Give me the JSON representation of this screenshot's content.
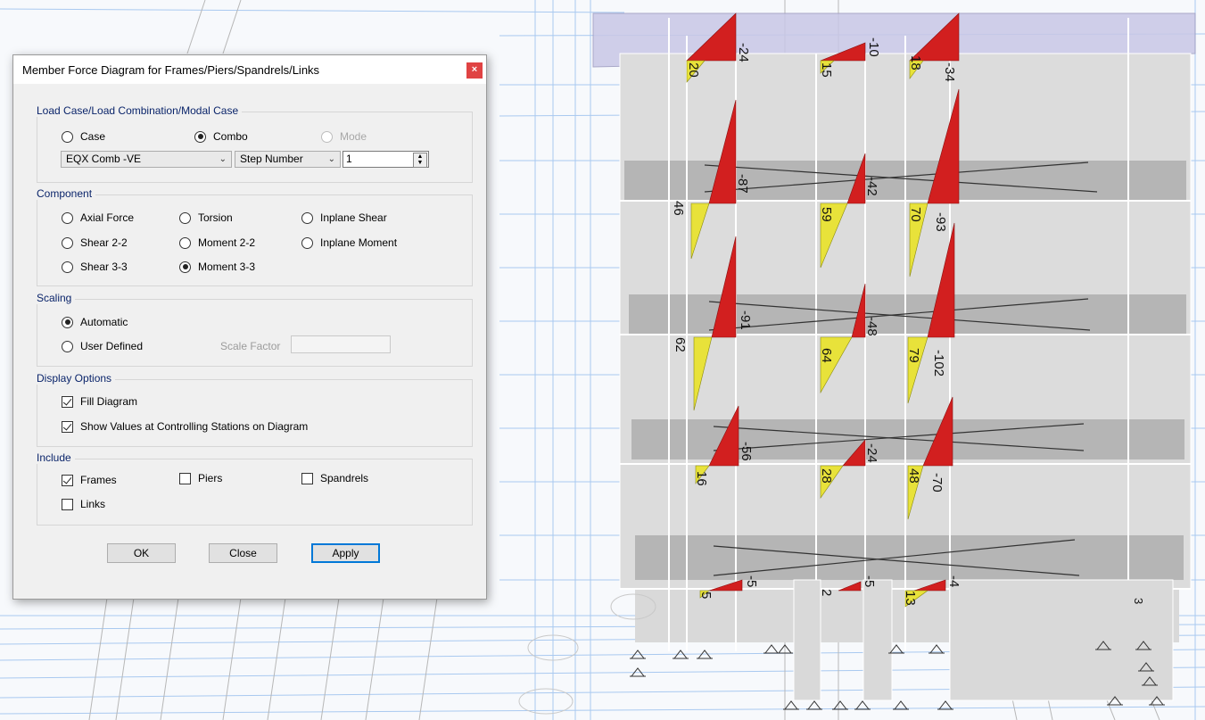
{
  "dialog": {
    "title": "Member Force Diagram for Frames/Piers/Spandrels/Links",
    "close_glyph": "×",
    "load_case_group": {
      "label": "Load Case/Load Combination/Modal Case",
      "options": [
        "Case",
        "Combo",
        "Mode"
      ],
      "selected": "Combo",
      "combo_value": "EQX Comb -VE",
      "step_type": "Step Number",
      "step_value": "1"
    },
    "component_group": {
      "label": "Component",
      "options": [
        "Axial Force",
        "Torsion",
        "Inplane Shear",
        "Shear 2-2",
        "Moment 2-2",
        "Inplane Moment",
        "Shear 3-3",
        "Moment 3-3"
      ],
      "selected": "Moment 3-3"
    },
    "scaling_group": {
      "label": "Scaling",
      "options": [
        "Automatic",
        "User Defined"
      ],
      "selected": "Automatic",
      "scale_factor_label": "Scale Factor",
      "scale_factor_value": ""
    },
    "display_group": {
      "label": "Display Options",
      "fill_diagram": "Fill Diagram",
      "show_values": "Show Values at Controlling Stations on Diagram",
      "fill_checked": true,
      "values_checked": true
    },
    "include_group": {
      "label": "Include",
      "frames": "Frames",
      "piers": "Piers",
      "spandrels": "Spandrels",
      "links": "Links",
      "frames_checked": true
    },
    "buttons": {
      "ok": "OK",
      "close": "Close",
      "apply": "Apply"
    }
  },
  "model_view": {
    "diagram_values": [
      "-24",
      "20",
      "-10",
      "15",
      "-34",
      "18",
      "-87",
      "46",
      "-42",
      "59",
      "-93",
      "70",
      "-91",
      "62",
      "-48",
      "64",
      "-102",
      "79",
      "-56",
      "16",
      "-24",
      "28",
      "-70",
      "48",
      "-5",
      "5",
      "-5",
      "2",
      "-4",
      "13",
      "3"
    ],
    "colors": {
      "negative": "#d21f1f",
      "positive": "#e8e23a",
      "grid": "#a9c9f0",
      "wall": "#d9d9d9",
      "slab": "#b3b3b3",
      "roof": "#c9c7e6"
    },
    "icons": [
      "support-pin-icon"
    ]
  }
}
